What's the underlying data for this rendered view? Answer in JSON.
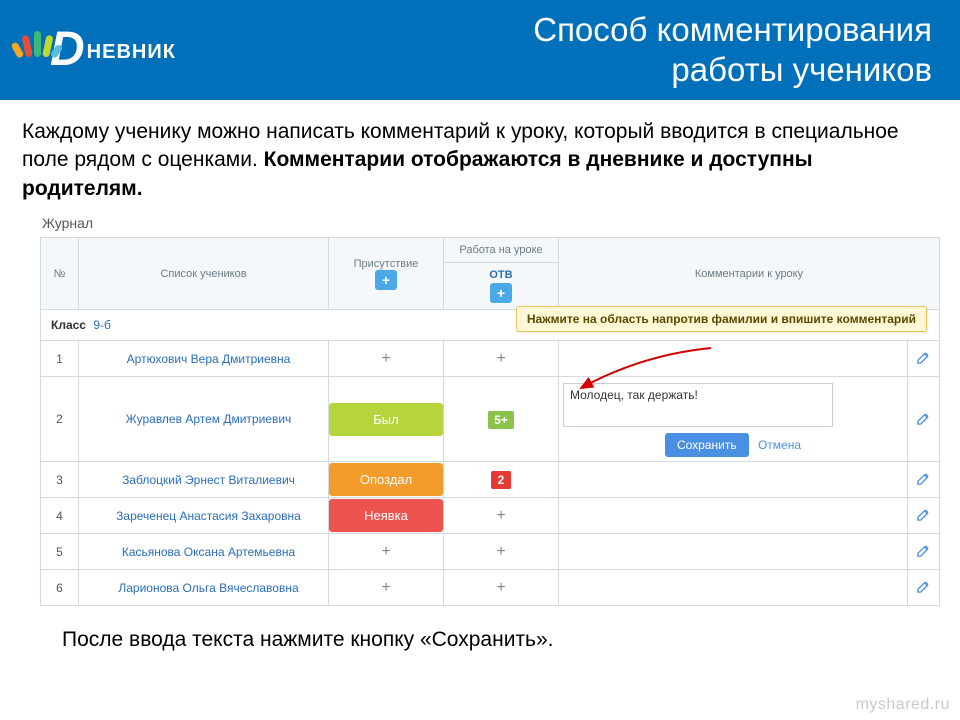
{
  "header": {
    "logo_text": "НЕВНИК",
    "title_line1": "Способ комментирования",
    "title_line2": "работы учеников"
  },
  "intro": {
    "part1": "Каждому ученику можно написать комментарий к уроку, который вводится в специальное поле рядом с оценками. ",
    "bold": "Комментарии отображаются в дневнике и доступны родителям."
  },
  "journal": {
    "label": "Журнал",
    "columns": {
      "no": "№",
      "students": "Список учеников",
      "attendance": "Присутствие",
      "work_group": "Работа на уроке",
      "work_sub": "ОТВ",
      "comments": "Комментарии к уроку"
    },
    "class_label": "Класс",
    "class_value": "9-б",
    "tooltip": "Нажмите на область напротив фамилии и впишите комментарий",
    "rows": [
      {
        "n": "1",
        "name": "Артюхович Вера Дмитриевна",
        "att": "+",
        "work": "+"
      },
      {
        "n": "2",
        "name": "Журавлев Артем Дмитриевич",
        "att_badge": "Был",
        "work_grade": "5+",
        "comment": "Молодец, так держать!"
      },
      {
        "n": "3",
        "name": "Заблоцкий Эрнест Виталиевич",
        "att_badge": "Опоздал",
        "work_grade": "2"
      },
      {
        "n": "4",
        "name": "Зареченец Анастасия Захаровна",
        "att_badge": "Неявка",
        "work": "+"
      },
      {
        "n": "5",
        "name": "Касьянова Оксана Артемьевна",
        "att": "+",
        "work": "+"
      },
      {
        "n": "6",
        "name": "Ларионова Ольга Вячеславовна",
        "att": "+",
        "work": "+"
      }
    ],
    "save_btn": "Сохранить",
    "cancel_btn": "Отмена"
  },
  "footer": "После ввода текста нажмите кнопку «Сохранить».",
  "watermark": "myshared.ru"
}
